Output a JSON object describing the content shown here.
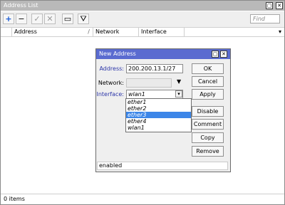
{
  "window": {
    "title": "Address List",
    "toolbar": {
      "icons": [
        "plus-icon",
        "minus-icon",
        "check-icon",
        "cross-icon",
        "note-icon",
        "filter-icon"
      ],
      "find_placeholder": "Find",
      "dropdown": "▾"
    },
    "columns": [
      "",
      "Address",
      "Network",
      "Interface"
    ],
    "sort_mark": "/",
    "status_text": "0 items"
  },
  "dialog": {
    "title": "New Address",
    "fields": {
      "address_label": "Address:",
      "address_value": "200.200.13.1/27",
      "network_label": "Network:",
      "network_value": "",
      "interface_label": "Interface:",
      "interface_value": "wlan1"
    },
    "interface_options": [
      "ether1",
      "ether2",
      "ether3",
      "ether4",
      "wlan1"
    ],
    "selected_option": "ether3",
    "buttons": [
      "OK",
      "Cancel",
      "Apply",
      "Disable",
      "Comment",
      "Copy",
      "Remove"
    ],
    "status": "enabled"
  }
}
